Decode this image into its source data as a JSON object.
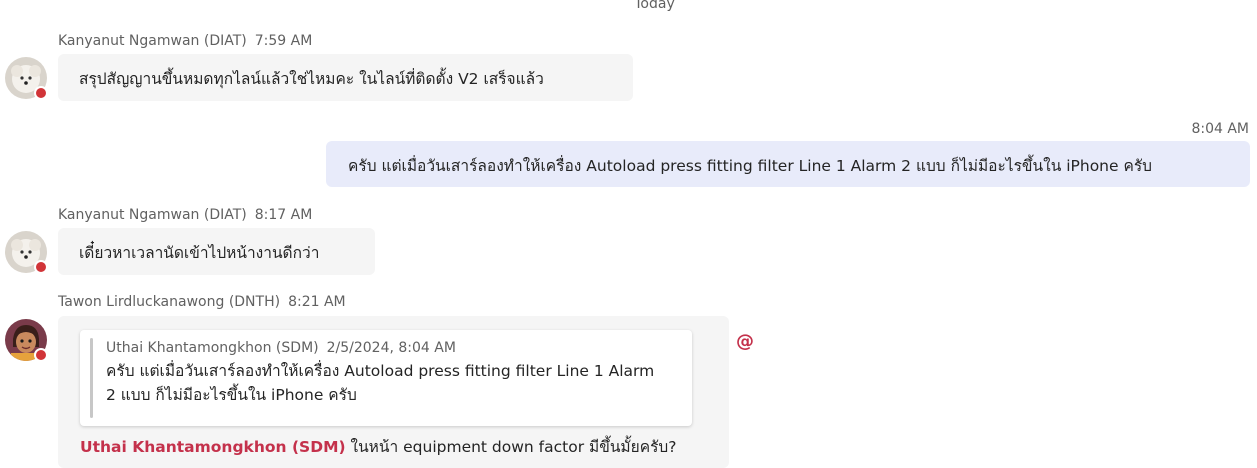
{
  "divider": {
    "label": "Today"
  },
  "messages": [
    {
      "sender": "Kanyanut Ngamwan (DIAT)",
      "time": "7:59 AM",
      "text": "สรุปสัญญานขึ้นหมดทุกไลน์แล้วใช่ไหมคะ ในไลน์ที่ติดตั้ง V2 เสร็จแล้ว"
    },
    {
      "own": true,
      "time": "8:04 AM",
      "text": "ครับ แต่เมื่อวันเสาร์ลองทำให้เครื่อง Autoload press fitting filter Line 1 Alarm 2 แบบ ก็ไม่มีอะไรขึ้นใน iPhone ครับ"
    },
    {
      "sender": "Kanyanut Ngamwan (DIAT)",
      "time": "8:17 AM",
      "text": "เดี๋ยวหาเวลานัดเข้าไปหน้างานดีกว่า"
    },
    {
      "sender": "Tawon Lirdluckanawong (DNTH)",
      "time": "8:21 AM",
      "quote": {
        "author": "Uthai Khantamongkhon (SDM)",
        "date": "2/5/2024, 8:04 AM",
        "text": "ครับ แต่เมื่อวันเสาร์ลองทำให้เครื่อง Autoload press fitting filter Line 1 Alarm 2 แบบ ก็ไม่มีอะไรขึ้นใน iPhone ครับ"
      },
      "mention": "Uthai Khantamongkhon (SDM)",
      "text": " ในหน้า equipment down factor มีขึ้นมั้ยครับ?",
      "mention_flag": "@"
    }
  ],
  "colors": {
    "own_bubble": "#e8ebfa",
    "other_bubble": "#f5f5f5",
    "mention": "#c4314b",
    "presence_busy": "#d13438"
  },
  "icons": {
    "avatar_1": "avatar-icon",
    "avatar_2": "avatar-icon",
    "presence": "presence-busy-icon"
  }
}
